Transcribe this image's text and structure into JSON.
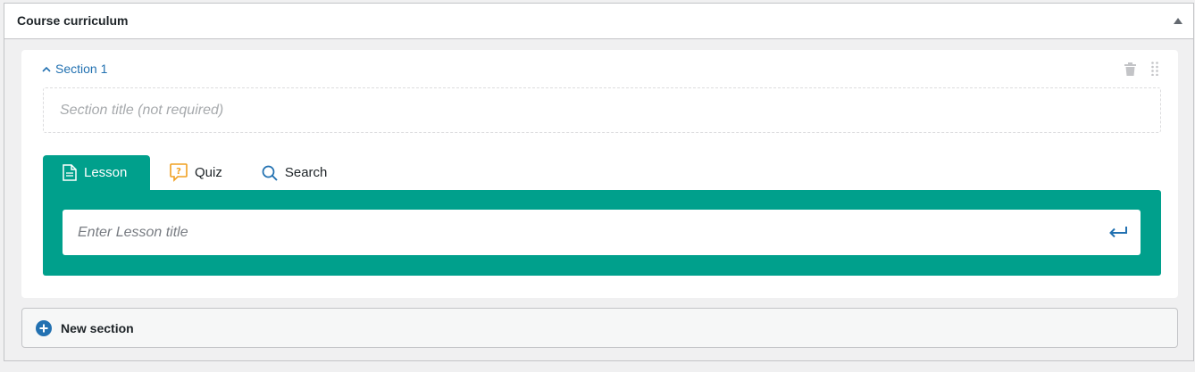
{
  "panel": {
    "title": "Course curriculum"
  },
  "section": {
    "toggle_label": "Section 1",
    "title_placeholder": "Section title (not required)"
  },
  "tabs": [
    {
      "label": "Lesson",
      "icon": "document-icon",
      "active": true
    },
    {
      "label": "Quiz",
      "icon": "quiz-icon",
      "active": false
    },
    {
      "label": "Search",
      "icon": "search-icon",
      "active": false
    }
  ],
  "lesson": {
    "placeholder": "Enter Lesson title"
  },
  "new_section": {
    "label": "New section"
  },
  "colors": {
    "accent": "#00a08c",
    "link": "#2271b1",
    "quiz_icon": "#f0a020"
  }
}
